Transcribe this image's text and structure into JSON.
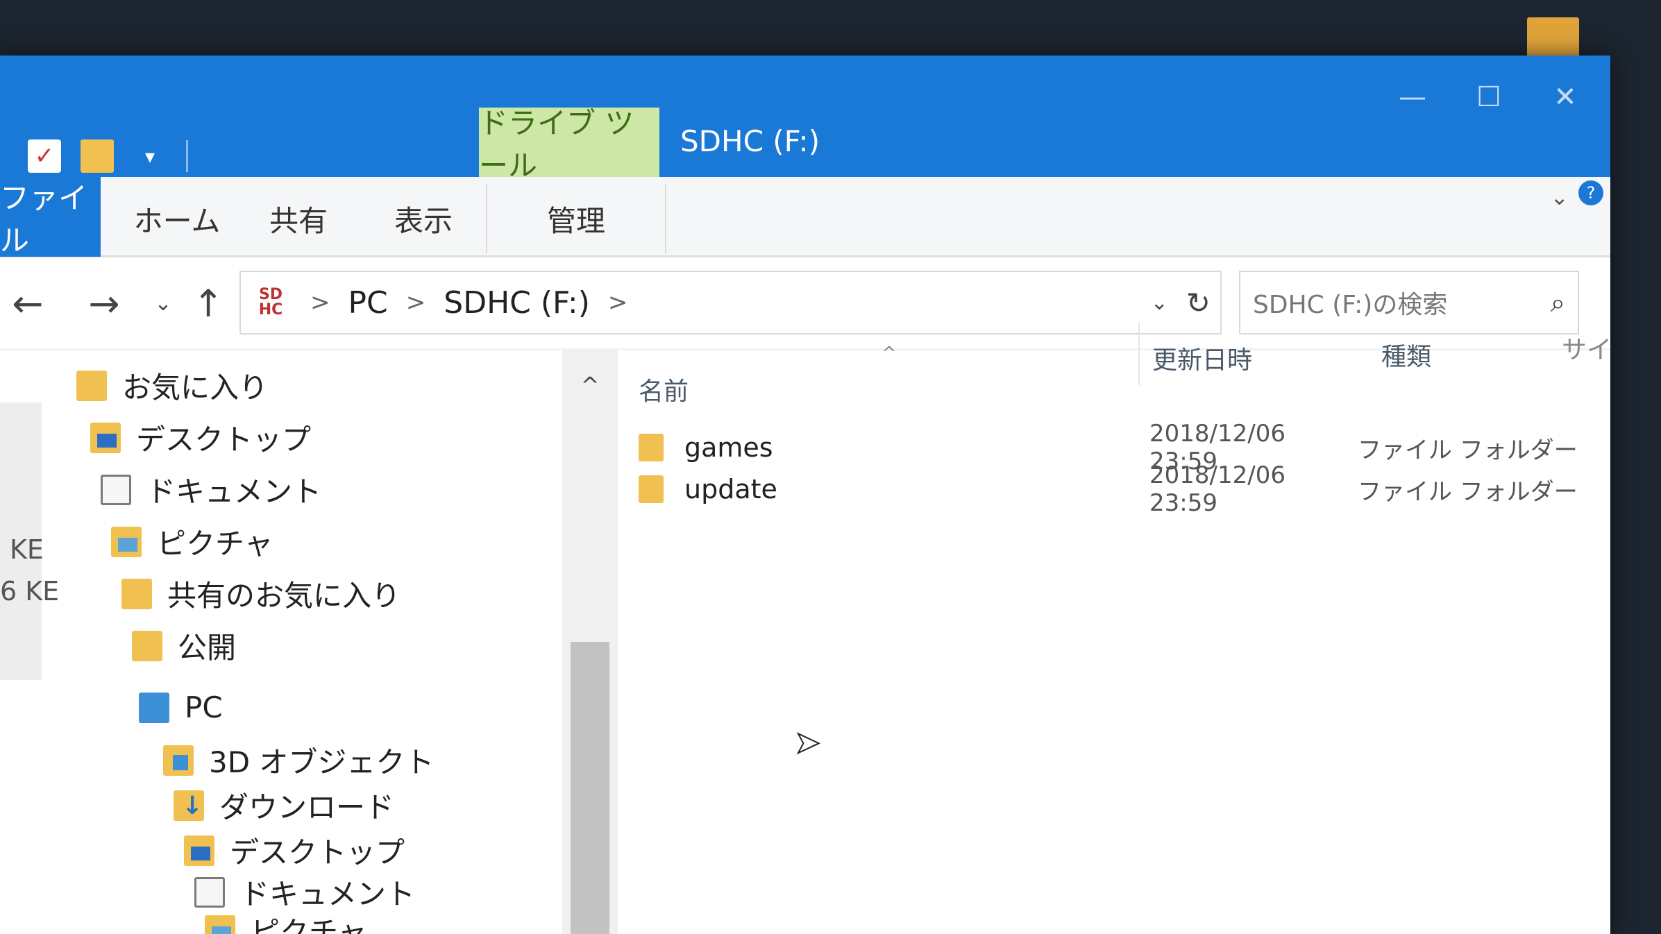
{
  "window": {
    "title": "SDHC (F:)",
    "contextual_tab": "ドライブ ツール",
    "controls": {
      "minimize": "—",
      "maximize": "☐",
      "close": "✕"
    }
  },
  "quick_access": {
    "dropdown": "▾"
  },
  "ribbon": {
    "tabs": {
      "file": "ファイル",
      "home": "ホーム",
      "share": "共有",
      "view": "表示",
      "manage": "管理"
    },
    "expand": "⌄",
    "help": "?"
  },
  "address": {
    "drive_icon_top": "SD",
    "drive_icon_bottom": "HC",
    "crumbs": [
      "PC",
      "SDHC (F:)"
    ],
    "separator": ">",
    "dropdown": "⌄",
    "refresh": "↻"
  },
  "search": {
    "placeholder": "SDHC (F:)の検索"
  },
  "nav": {
    "back": "←",
    "forward": "→",
    "recent": "⌄",
    "up": "↑",
    "items": [
      {
        "label": "お気に入り",
        "icon": "folder-icon"
      },
      {
        "label": "デスクトップ",
        "icon": "desktop-icon"
      },
      {
        "label": "ドキュメント",
        "icon": "documents-icon"
      },
      {
        "label": "ピクチャ",
        "icon": "pictures-icon"
      },
      {
        "label": "共有のお気に入り",
        "icon": "folder-icon"
      },
      {
        "label": "公開",
        "icon": "folder-icon"
      },
      {
        "label": "PC",
        "icon": "pc-icon"
      },
      {
        "label": "3D オブジェクト",
        "icon": "3d-objects-icon"
      },
      {
        "label": "ダウンロード",
        "icon": "downloads-icon"
      },
      {
        "label": "デスクトップ",
        "icon": "desktop-icon"
      },
      {
        "label": "ドキュメント",
        "icon": "documents-icon"
      },
      {
        "label": "ピクチャ",
        "icon": "pictures-icon"
      }
    ],
    "scroll_up": "^"
  },
  "columns": {
    "name": "名前",
    "date": "更新日時",
    "type": "種類",
    "size": "サイ",
    "sort": "^"
  },
  "files": [
    {
      "name": "games",
      "date": "2018/12/06 23:59",
      "type": "ファイル フォルダー"
    },
    {
      "name": "update",
      "date": "2018/12/06 23:59",
      "type": "ファイル フォルダー"
    }
  ],
  "left_edge": [
    "KE",
    "6 KE"
  ]
}
